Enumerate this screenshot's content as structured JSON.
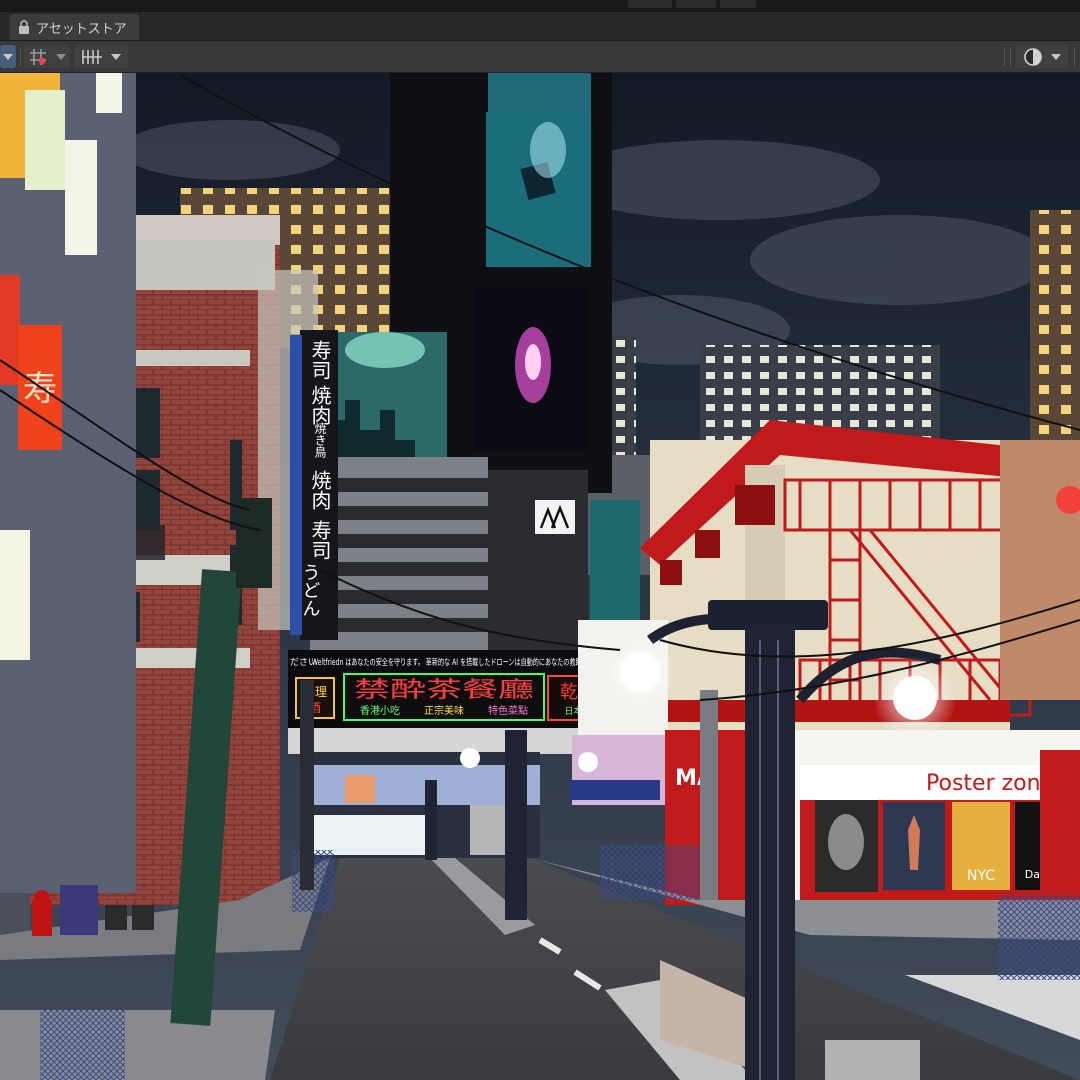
{
  "window": {
    "tab_title": "アセットストア",
    "tab_icon": "lock-icon"
  },
  "toolbar": {
    "left_tools": [
      "shading-mode-icon",
      "grid-snap-icon",
      "grid-visibility-icon"
    ],
    "right_tools": [
      "gizmos-render-icon"
    ]
  },
  "scene": {
    "vertical_sign_left": "寿司",
    "vertical_sign_middle": "焼肉",
    "vertical_sign_small": "焼き鳥",
    "vertical_sign_lower_1": "焼肉",
    "vertical_sign_lower_2": "寿司",
    "vertical_sign_lower_3": "うどん",
    "ticker_text": "Weltfriedn はあなたの安全を守ります。 革新的な AI を搭載したドローンは自動的にあなたの救助を行います",
    "ticker_prefix": "ださい",
    "neon_main": "禁酔茶餐廳",
    "neon_main_sub_1": "香港小吃",
    "neon_main_sub_2": "正宗美味",
    "neon_main_sub_3": "特色菜點",
    "neon_right": "乾杯",
    "neon_right_sub": "日本酒",
    "neon_left_top": "料理",
    "neon_left_bottom": "酒",
    "left_red_sign": "寿",
    "left_red_sign_2": "",
    "shop_sign_left": "MA",
    "poster_zone_sign": "Poster zone",
    "poster_1_caption": "",
    "poster_3_caption": "NYC",
    "poster_4_caption": "Daisy",
    "building_logo": "logo-icon"
  }
}
